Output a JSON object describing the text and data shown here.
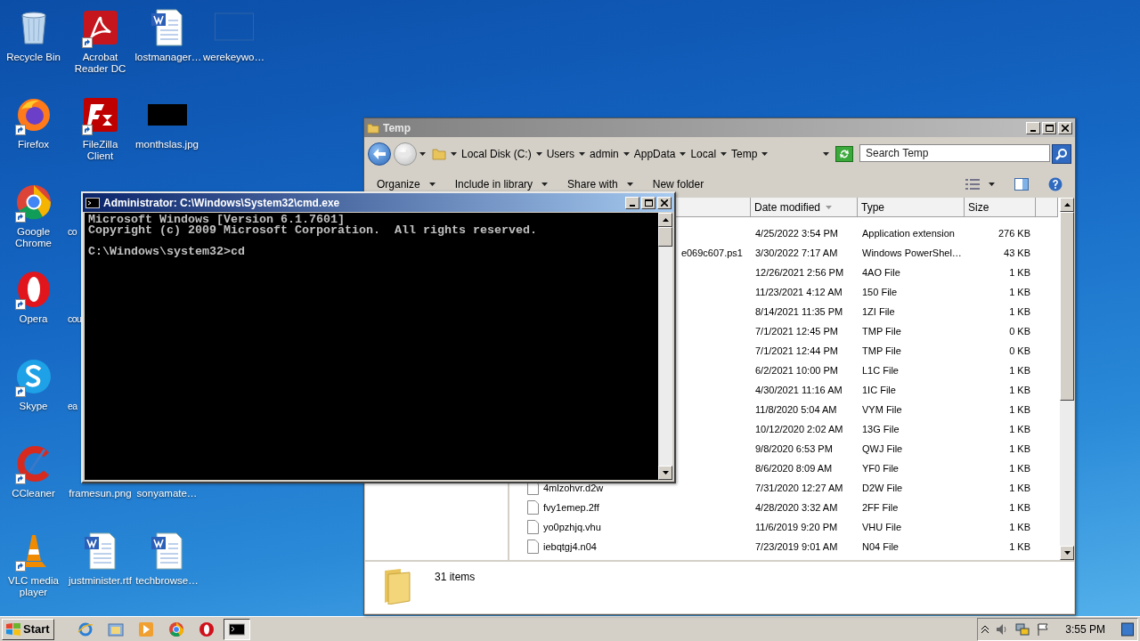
{
  "desktop": {
    "rows": [
      [
        {
          "label": "Recycle Bin",
          "kind": "recycle",
          "shortcut": false
        },
        {
          "label": "Acrobat Reader DC",
          "kind": "pdf",
          "shortcut": true
        },
        {
          "label": "lostmanager…",
          "kind": "word",
          "shortcut": false
        },
        {
          "label": "werekeywo…",
          "kind": "blank",
          "shortcut": false
        }
      ],
      [
        {
          "label": "Firefox",
          "kind": "firefox",
          "shortcut": true
        },
        {
          "label": "FileZilla Client",
          "kind": "filezilla",
          "shortcut": true
        },
        {
          "label": "monthslas.jpg",
          "kind": "dark-image",
          "shortcut": false
        }
      ],
      [
        {
          "label": "Google Chrome",
          "kind": "chrome",
          "shortcut": true
        },
        {
          "label": "co",
          "kind": "cut",
          "shortcut": false
        }
      ],
      [
        {
          "label": "Opera",
          "kind": "opera",
          "shortcut": true
        },
        {
          "label": "cou",
          "kind": "cut",
          "shortcut": false
        }
      ],
      [
        {
          "label": "Skype",
          "kind": "skype",
          "shortcut": true
        },
        {
          "label": "ea",
          "kind": "cut",
          "shortcut": false
        }
      ],
      [
        {
          "label": "CCleaner",
          "kind": "ccleaner",
          "shortcut": true
        },
        {
          "label": "framesun.png",
          "kind": "covered",
          "shortcut": false
        },
        {
          "label": "sonyamate…",
          "kind": "covered",
          "shortcut": false
        }
      ],
      [
        {
          "label": "VLC media player",
          "kind": "vlc",
          "shortcut": true
        },
        {
          "label": "justminister.rtf",
          "kind": "word",
          "shortcut": false
        },
        {
          "label": "techbrowse…",
          "kind": "word",
          "shortcut": false
        }
      ]
    ]
  },
  "explorer": {
    "title": "Temp",
    "breadcrumb": [
      "Local Disk (C:)",
      "Users",
      "admin",
      "AppData",
      "Local",
      "Temp"
    ],
    "search": {
      "placeholder": "Search Temp"
    },
    "toolbar": [
      {
        "label": "Organize",
        "menu": true
      },
      {
        "label": "Include in library",
        "menu": true
      },
      {
        "label": "Share with",
        "menu": true
      },
      {
        "label": "New folder",
        "menu": false
      }
    ],
    "columns": [
      {
        "label": "Date modified",
        "sorted": true
      },
      {
        "label": "Type",
        "sorted": false
      },
      {
        "label": "Size",
        "sorted": false
      }
    ],
    "rows": [
      {
        "kind": "covered",
        "date": "4/25/2022 3:54 PM",
        "type": "Application extension",
        "size": "276 KB"
      },
      {
        "kind": "cut",
        "name": "e069c607.ps1",
        "date": "3/30/2022 7:17 AM",
        "type": "Windows PowerShel…",
        "size": "43 KB"
      },
      {
        "kind": "covered",
        "date": "12/26/2021 2:56 PM",
        "type": "4AO File",
        "size": "1 KB"
      },
      {
        "kind": "covered",
        "date": "11/23/2021 4:12 AM",
        "type": "150 File",
        "size": "1 KB"
      },
      {
        "kind": "covered",
        "date": "8/14/2021 11:35 PM",
        "type": "1ZI File",
        "size": "1 KB"
      },
      {
        "kind": "covered",
        "date": "7/1/2021 12:45 PM",
        "type": "TMP File",
        "size": "0 KB"
      },
      {
        "kind": "covered",
        "date": "7/1/2021 12:44 PM",
        "type": "TMP File",
        "size": "0 KB"
      },
      {
        "kind": "covered",
        "date": "6/2/2021 10:00 PM",
        "type": "L1C File",
        "size": "1 KB"
      },
      {
        "kind": "covered",
        "date": "4/30/2021 11:16 AM",
        "type": "1IC File",
        "size": "1 KB"
      },
      {
        "kind": "covered",
        "date": "11/8/2020 5:04 AM",
        "type": "VYM File",
        "size": "1 KB"
      },
      {
        "kind": "covered",
        "date": "10/12/2020 2:02 AM",
        "type": "13G File",
        "size": "1 KB"
      },
      {
        "kind": "covered",
        "date": "9/8/2020 6:53 PM",
        "type": "QWJ File",
        "size": "1 KB"
      },
      {
        "kind": "covered",
        "date": "8/6/2020 8:09 AM",
        "type": "YF0 File",
        "size": "1 KB"
      },
      {
        "kind": "file",
        "name": "4mlzohvr.d2w",
        "date": "7/31/2020 12:27 AM",
        "type": "D2W File",
        "size": "1 KB"
      },
      {
        "kind": "file",
        "name": "fvy1emep.2ff",
        "date": "4/28/2020 3:32 AM",
        "type": "2FF File",
        "size": "1 KB"
      },
      {
        "kind": "file",
        "name": "yo0pzhjq.vhu",
        "date": "11/6/2019 9:20 PM",
        "type": "VHU File",
        "size": "1 KB"
      },
      {
        "kind": "file",
        "name": "iebqtgj4.n04",
        "date": "7/23/2019 9:01 AM",
        "type": "N04 File",
        "size": "1 KB"
      }
    ],
    "status": "31 items"
  },
  "console": {
    "title": "Administrator: C:\\Windows\\System32\\cmd.exe",
    "lines": [
      "Microsoft Windows [Version 6.1.7601]",
      "Copyright (c) 2009 Microsoft Corporation.  All rights reserved."
    ],
    "prompt": "C:\\Windows\\system32>cd"
  },
  "taskbar": {
    "start": "Start",
    "apps": [
      {
        "kind": "ie",
        "active": false
      },
      {
        "kind": "folder",
        "active": false
      },
      {
        "kind": "media",
        "active": false
      },
      {
        "kind": "chrome",
        "active": false
      },
      {
        "kind": "opera",
        "active": false
      },
      {
        "kind": "console",
        "active": true
      }
    ],
    "clock": "3:55 PM"
  }
}
